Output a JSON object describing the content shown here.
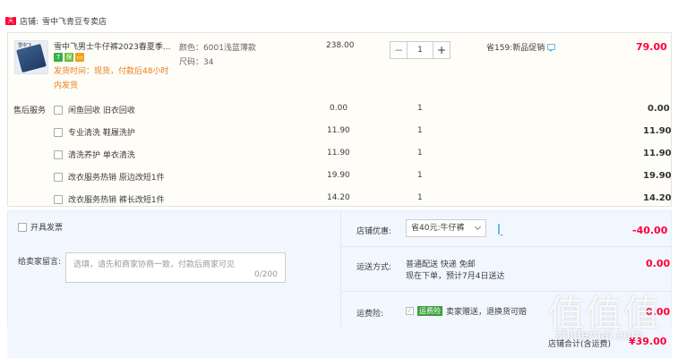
{
  "store": {
    "badge": "天猫",
    "label": "店铺:",
    "name": "雪中飞青豆专卖店"
  },
  "item": {
    "title": "雪中飞男士牛仔裤2023春夏季...",
    "image_tag": "雪中飞",
    "icons": [
      {
        "name": "seven-day-return-icon",
        "text": "7",
        "color": "#2fb344"
      },
      {
        "name": "guarantee-icon",
        "text": "保",
        "color": "#6cbf3a"
      },
      {
        "name": "card-payment-icon",
        "text": "▭",
        "color": "#f0a21c"
      }
    ],
    "ship_note": "发货时间：现货，付款后48小时内发货",
    "color_label": "颜色：",
    "color_value": "6001浅蓝薄款",
    "size_label": "尺码：",
    "size_value": "34",
    "price": "238.00",
    "qty": "1",
    "minus": "−",
    "plus": "+",
    "promo": "省159:新品促销",
    "total": "79.00"
  },
  "services": {
    "label": "售后服务",
    "rows": [
      {
        "name": "闲鱼回收 旧衣回收",
        "price": "0.00",
        "qty": "1",
        "total": "0.00"
      },
      {
        "name": "专业清洗 鞋履洗护",
        "price": "11.90",
        "qty": "1",
        "total": "11.90"
      },
      {
        "name": "清洗养护 单衣清洗",
        "price": "11.90",
        "qty": "1",
        "total": "11.90"
      },
      {
        "name": "改衣服务热销 原边改短1件",
        "price": "19.90",
        "qty": "1",
        "total": "19.90"
      },
      {
        "name": "改衣服务热销 裤长改短1件",
        "price": "14.20",
        "qty": "1",
        "total": "14.20"
      }
    ]
  },
  "invoice": {
    "label": "开具发票"
  },
  "message": {
    "label": "给卖家留言:",
    "placeholder": "选填，请先和商家协商一致，付款后商家可见",
    "count": "0/200"
  },
  "discount": {
    "label": "店铺优惠:",
    "selected": "省40元:牛仔裤",
    "amount": "-40.00"
  },
  "shipping": {
    "label": "运送方式:",
    "line1": "普通配送 快递 免邮",
    "line2": "现在下单，预计7月4日送达",
    "amount": "0.00"
  },
  "insurance": {
    "label": "运费险:",
    "check": "✓",
    "badge": "运费险",
    "text": "卖家赠送，退换货可赔",
    "amount": "0.00"
  },
  "summary": {
    "label": "店铺合计(含运费)",
    "total": "¥39.00"
  },
  "watermark": {
    "big": "值值值",
    "small": "zhidemai.com"
  },
  "colors": {
    "accent_red": "#ff0036",
    "ship_orange": "#e77f1e",
    "panel_blue": "#f2f7ff"
  }
}
